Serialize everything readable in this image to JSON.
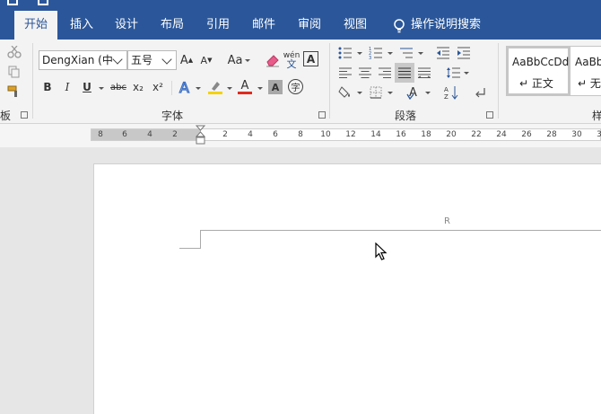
{
  "tabs": [
    {
      "label": "开始",
      "active": true
    },
    {
      "label": "插入"
    },
    {
      "label": "设计"
    },
    {
      "label": "布局"
    },
    {
      "label": "引用"
    },
    {
      "label": "邮件"
    },
    {
      "label": "审阅"
    },
    {
      "label": "视图"
    }
  ],
  "tell_me": {
    "label": "操作说明搜索"
  },
  "font_group": {
    "label": "字体",
    "font_name": "DengXian (中",
    "font_size": "五号",
    "change_case": "Aa",
    "bold": "B",
    "italic": "I",
    "underline": "U",
    "strike": "abc",
    "subscript": "x₂",
    "superscript": "x²",
    "phonetic_top": "wén",
    "phonetic_bottom": "文",
    "char_border": "A",
    "font_color": "A",
    "char_shading": "A",
    "enclose": "字"
  },
  "clipboard_group": {
    "label": "板"
  },
  "paragraph_group": {
    "label": "段落"
  },
  "styles_group": {
    "label": "样",
    "items": [
      {
        "preview": "AaBbCcDd",
        "name": "↵ 正文"
      },
      {
        "preview": "AaBbC",
        "name": "↵ 无"
      }
    ]
  },
  "ruler": {
    "labels": [
      "8",
      "6",
      "4",
      "2",
      "2",
      "4",
      "6",
      "8",
      "10",
      "12",
      "14",
      "16",
      "18",
      "20",
      "22",
      "24",
      "26",
      "28",
      "30",
      "3"
    ]
  },
  "document": {
    "header_mark": "R"
  },
  "colors": {
    "accent": "#2b579a",
    "highlight": "#f5d200",
    "font_color": "#e02a1e"
  }
}
